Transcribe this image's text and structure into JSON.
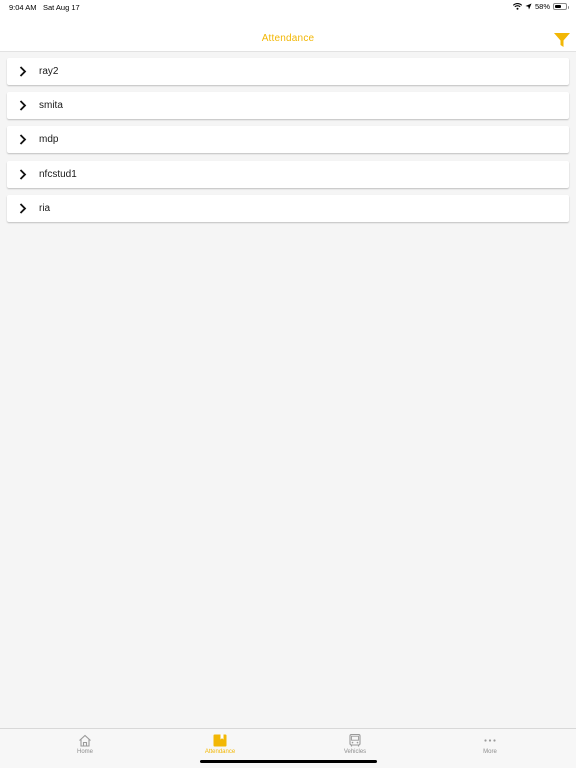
{
  "status_bar": {
    "time": "9:04 AM",
    "date": "Sat Aug 17",
    "battery": "58%",
    "battery_level": 0.58
  },
  "nav": {
    "title": "Attendance",
    "filter_icon": "filter-icon"
  },
  "list": {
    "items": [
      {
        "label": "ray2"
      },
      {
        "label": "smita"
      },
      {
        "label": "mdp"
      },
      {
        "label": "nfcstud1"
      },
      {
        "label": "ria"
      }
    ]
  },
  "tabs": [
    {
      "label": "Home",
      "icon": "home-icon",
      "active": false
    },
    {
      "label": "Attendance",
      "icon": "attendance-icon",
      "active": true
    },
    {
      "label": "Vehicles",
      "icon": "bus-icon",
      "active": false
    },
    {
      "label": "More",
      "icon": "more-icon",
      "active": false
    }
  ],
  "colors": {
    "accent": "#f2b705",
    "background": "#f5f5f5",
    "inactive_tab": "#8e8e8e"
  }
}
